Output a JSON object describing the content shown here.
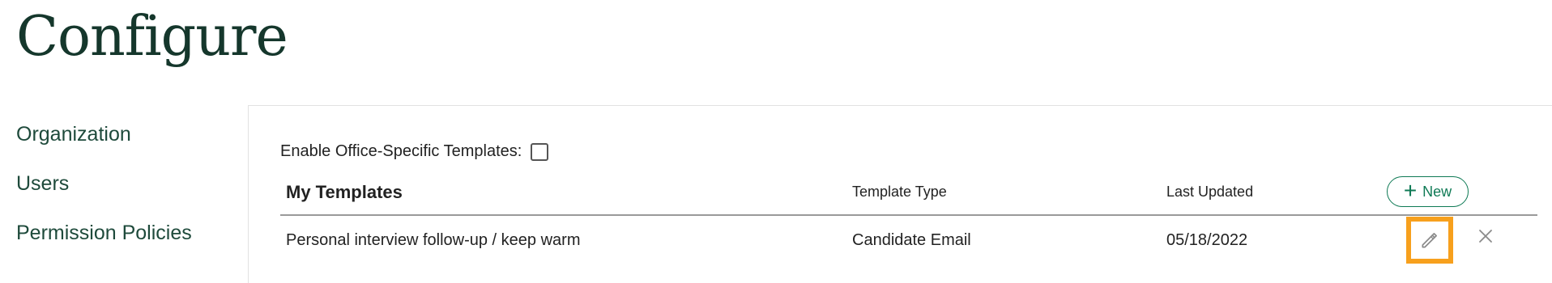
{
  "colors": {
    "title": "#15372c",
    "sidebar_text": "#1e4a3b",
    "accent": "#0f7a55",
    "highlight": "#f7a01d",
    "icon_gray": "#8a8a8a"
  },
  "header": {
    "title": "Configure"
  },
  "sidebar": {
    "items": [
      {
        "label": "Organization"
      },
      {
        "label": "Users"
      },
      {
        "label": "Permission Policies"
      }
    ]
  },
  "main": {
    "toggle_label": "Enable Office-Specific Templates:",
    "toggle_checked": false,
    "table": {
      "headers": {
        "name": "My Templates",
        "type": "Template Type",
        "updated": "Last Updated"
      },
      "new_button_label": "New",
      "rows": [
        {
          "name": "Personal interview follow-up / keep warm",
          "type": "Candidate Email",
          "updated": "05/18/2022"
        }
      ]
    }
  },
  "icons": {
    "new": "plus-icon",
    "edit": "pencil-icon",
    "delete": "close-icon"
  }
}
